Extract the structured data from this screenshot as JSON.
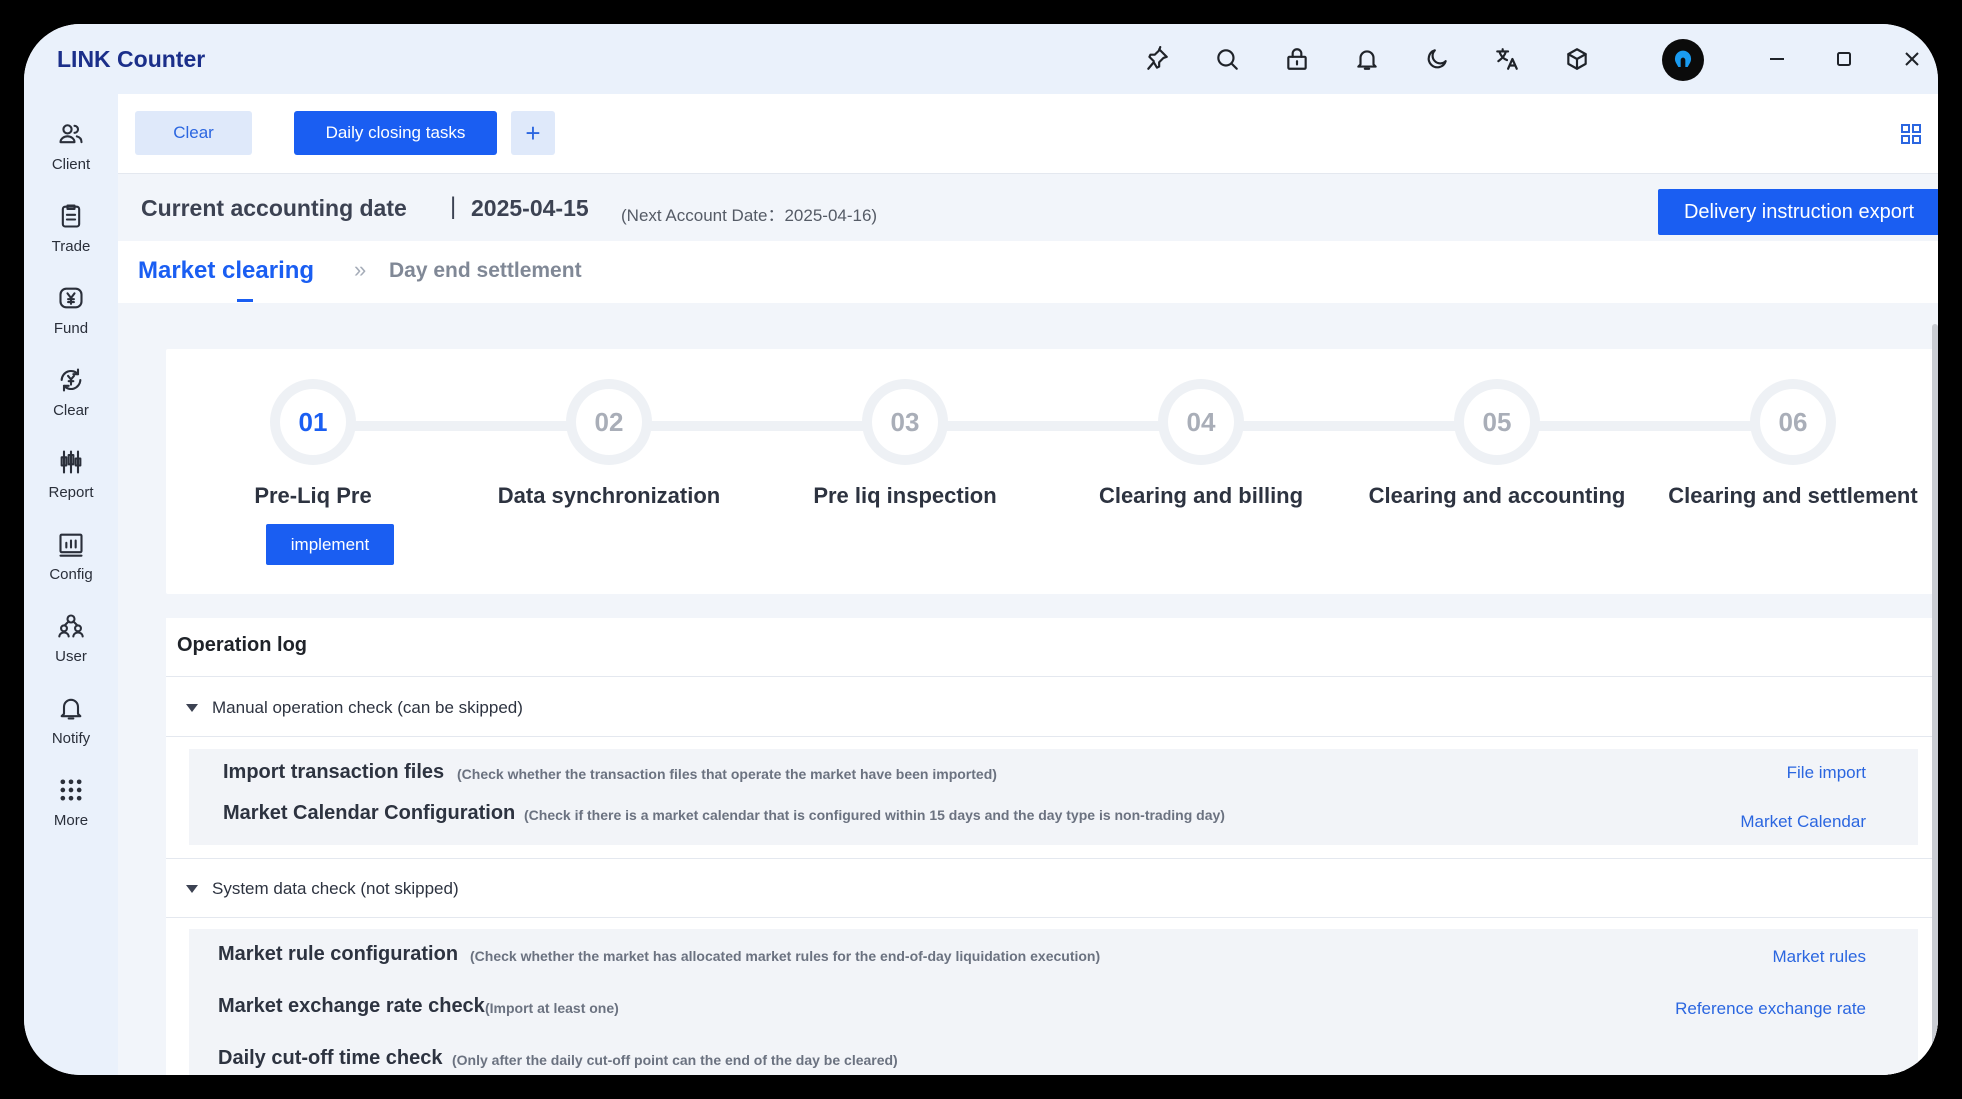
{
  "app": {
    "title": "LINK Counter"
  },
  "titlebar_icons": [
    "pin-icon",
    "search-icon",
    "lock-icon",
    "bell-icon",
    "moon-icon",
    "translate-icon",
    "cube-icon"
  ],
  "sidebar": {
    "items": [
      {
        "label": "Client",
        "icon": "users-icon"
      },
      {
        "label": "Trade",
        "icon": "document-icon"
      },
      {
        "label": "Fund",
        "icon": "yen-icon"
      },
      {
        "label": "Clear",
        "icon": "yen-refresh-icon"
      },
      {
        "label": "Report",
        "icon": "candlestick-icon"
      },
      {
        "label": "Config",
        "icon": "chart-icon"
      },
      {
        "label": "User",
        "icon": "user-group-icon"
      },
      {
        "label": "Notify",
        "icon": "bell-icon"
      },
      {
        "label": "More",
        "icon": "grid-dots-icon"
      }
    ]
  },
  "tabs": {
    "clear": "Clear",
    "daily": "Daily closing tasks",
    "add": "+"
  },
  "datebar": {
    "label": "Current accounting date",
    "separator": "|",
    "date": "2025-04-15",
    "next": "(Next Account Date：2025-04-16)",
    "export_button": "Delivery instruction export"
  },
  "breadcrumb": {
    "active": "Market clearing",
    "separator": "»",
    "next": "Day end settlement"
  },
  "steps": [
    {
      "num": "01",
      "title": "Pre-Liq Pre",
      "active": true
    },
    {
      "num": "02",
      "title": "Data synchronization"
    },
    {
      "num": "03",
      "title": "Pre liq inspection"
    },
    {
      "num": "04",
      "title": "Clearing and billing"
    },
    {
      "num": "05",
      "title": "Clearing and accounting"
    },
    {
      "num": "06",
      "title": "Clearing and settlement"
    }
  ],
  "implement_button": "implement",
  "log": {
    "title": "Operation log",
    "groups": [
      {
        "label": "Manual operation check (can be skipped)",
        "items": [
          {
            "name": "Import transaction files",
            "desc": "(Check whether the transaction files that operate the market have been imported)",
            "link": "File import"
          },
          {
            "name": "Market Calendar Configuration",
            "desc": "(Check if there is a market calendar that is configured within 15 days and the day type is non-trading day)",
            "link": "Market Calendar"
          }
        ]
      },
      {
        "label": "System data check (not skipped)",
        "items": [
          {
            "name": "Market rule configuration",
            "desc": "(Check whether the market has allocated market rules for the end-of-day liquidation execution)",
            "link": "Market rules"
          },
          {
            "name": "Market exchange rate check",
            "desc": "(Import at least one)",
            "link": "Reference exchange rate"
          },
          {
            "name": "Daily cut-off time check",
            "desc": "(Only after the daily cut-off point can the end of the day be cleared)",
            "link": ""
          }
        ]
      }
    ]
  },
  "colors": {
    "primary": "#1a5ef2",
    "sidebar_bg": "#eaf1fb",
    "main_bg": "#f2f5fa"
  }
}
